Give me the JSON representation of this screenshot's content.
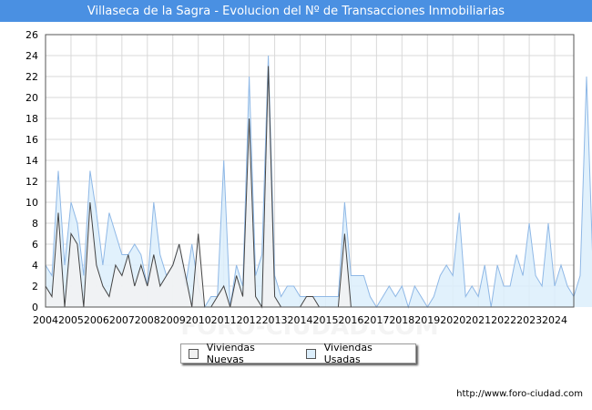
{
  "title": "Villaseca de la Sagra - Evolucion del Nº de Transacciones Inmobiliarias",
  "footer": "http://www.foro-ciudad.com",
  "watermark": "FORO-CIUDAD.COM",
  "colors": {
    "title_bg": "#4a90e2",
    "nuevas_fill": "#f2f2f2",
    "nuevas_line": "#444444",
    "usadas_fill": "#dceefb",
    "usadas_line": "#8fb8e6",
    "grid": "#d9d9d9"
  },
  "legend": {
    "nuevas": "Viviendas Nuevas",
    "usadas": "Viviendas Usadas"
  },
  "chart_data": {
    "type": "area",
    "x_start": 2004.0,
    "x_step": 0.25,
    "xlim": [
      2004,
      2024.75
    ],
    "ylim": [
      0,
      26
    ],
    "yticks": [
      0,
      2,
      4,
      6,
      8,
      10,
      12,
      14,
      16,
      18,
      20,
      22,
      24,
      26
    ],
    "xtick_labels": [
      "2004",
      "2005",
      "2006",
      "2007",
      "2008",
      "2009",
      "2010",
      "2011",
      "2012",
      "2013",
      "2014",
      "2015",
      "2016",
      "2017",
      "2018",
      "2019",
      "2020",
      "2021",
      "2022",
      "2023",
      "2024"
    ],
    "grid": true,
    "legend_position": "bottom-center",
    "series": [
      {
        "name": "Viviendas Nuevas",
        "values": [
          2,
          1,
          9,
          0,
          7,
          6,
          0,
          10,
          4,
          2,
          1,
          4,
          3,
          5,
          2,
          4,
          2,
          5,
          2,
          3,
          4,
          6,
          3,
          0,
          7,
          0,
          0,
          1,
          2,
          0,
          3,
          1,
          18,
          1,
          0,
          23,
          1,
          0,
          0,
          0,
          0,
          1,
          1,
          0,
          0,
          0,
          0,
          7,
          0,
          0,
          0,
          0,
          0,
          0,
          0,
          0,
          0,
          0,
          0,
          0,
          0,
          0,
          0,
          0,
          0,
          0,
          0,
          0,
          0,
          0,
          0,
          0,
          0,
          0,
          0,
          0,
          0,
          0,
          0,
          0,
          0,
          0,
          0,
          0
        ]
      },
      {
        "name": "Viviendas Usadas",
        "values": [
          4,
          3,
          13,
          4,
          10,
          8,
          3,
          13,
          9,
          4,
          9,
          7,
          5,
          5,
          6,
          5,
          2,
          10,
          5,
          3,
          4,
          6,
          2,
          6,
          2,
          0,
          1,
          1,
          14,
          0,
          4,
          2,
          22,
          3,
          5,
          24,
          3,
          1,
          2,
          2,
          1,
          1,
          1,
          1,
          1,
          1,
          1,
          10,
          3,
          3,
          3,
          1,
          0,
          1,
          2,
          1,
          2,
          0,
          2,
          1,
          0,
          1,
          3,
          4,
          3,
          9,
          1,
          2,
          1,
          4,
          0,
          4,
          2,
          2,
          5,
          3,
          8,
          3,
          2,
          8,
          2,
          4,
          2,
          1,
          3,
          22,
          4
        ]
      }
    ]
  }
}
